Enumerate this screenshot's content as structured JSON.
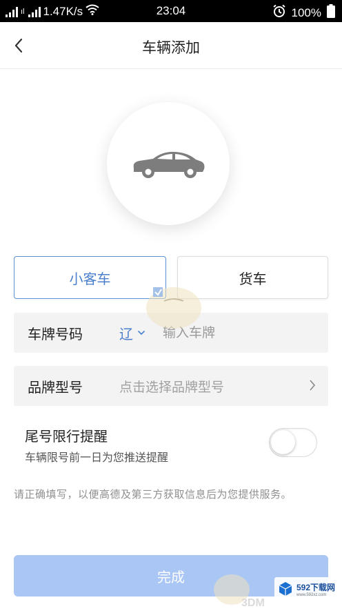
{
  "status_bar": {
    "sim_label": "ıl",
    "network_speed": "1.47K/s",
    "time": "23:04",
    "battery": "100%"
  },
  "header": {
    "title": "车辆添加"
  },
  "vehicle_types": {
    "car_label": "小客车",
    "truck_label": "货车",
    "selected": "小客车"
  },
  "plate": {
    "label": "车牌号码",
    "province": "辽",
    "placeholder": "输入车牌",
    "value": ""
  },
  "brand": {
    "label": "品牌型号",
    "placeholder": "点击选择品牌型号"
  },
  "tail_reminder": {
    "title": "尾号限行提醒",
    "description": "车辆限号前一日为您推送提醒",
    "enabled": false
  },
  "notice": "请正确填写，以便高德及第三方获取信息后为您提供服务。",
  "submit_label": "完成",
  "watermark": {
    "brand": "592下载网",
    "url": "www.592xz.com",
    "sub_brand": "3DM"
  },
  "colors": {
    "accent": "#4a7fcc",
    "submit_disabled": "#a9c6f5",
    "field_bg": "#f3f3f3"
  }
}
